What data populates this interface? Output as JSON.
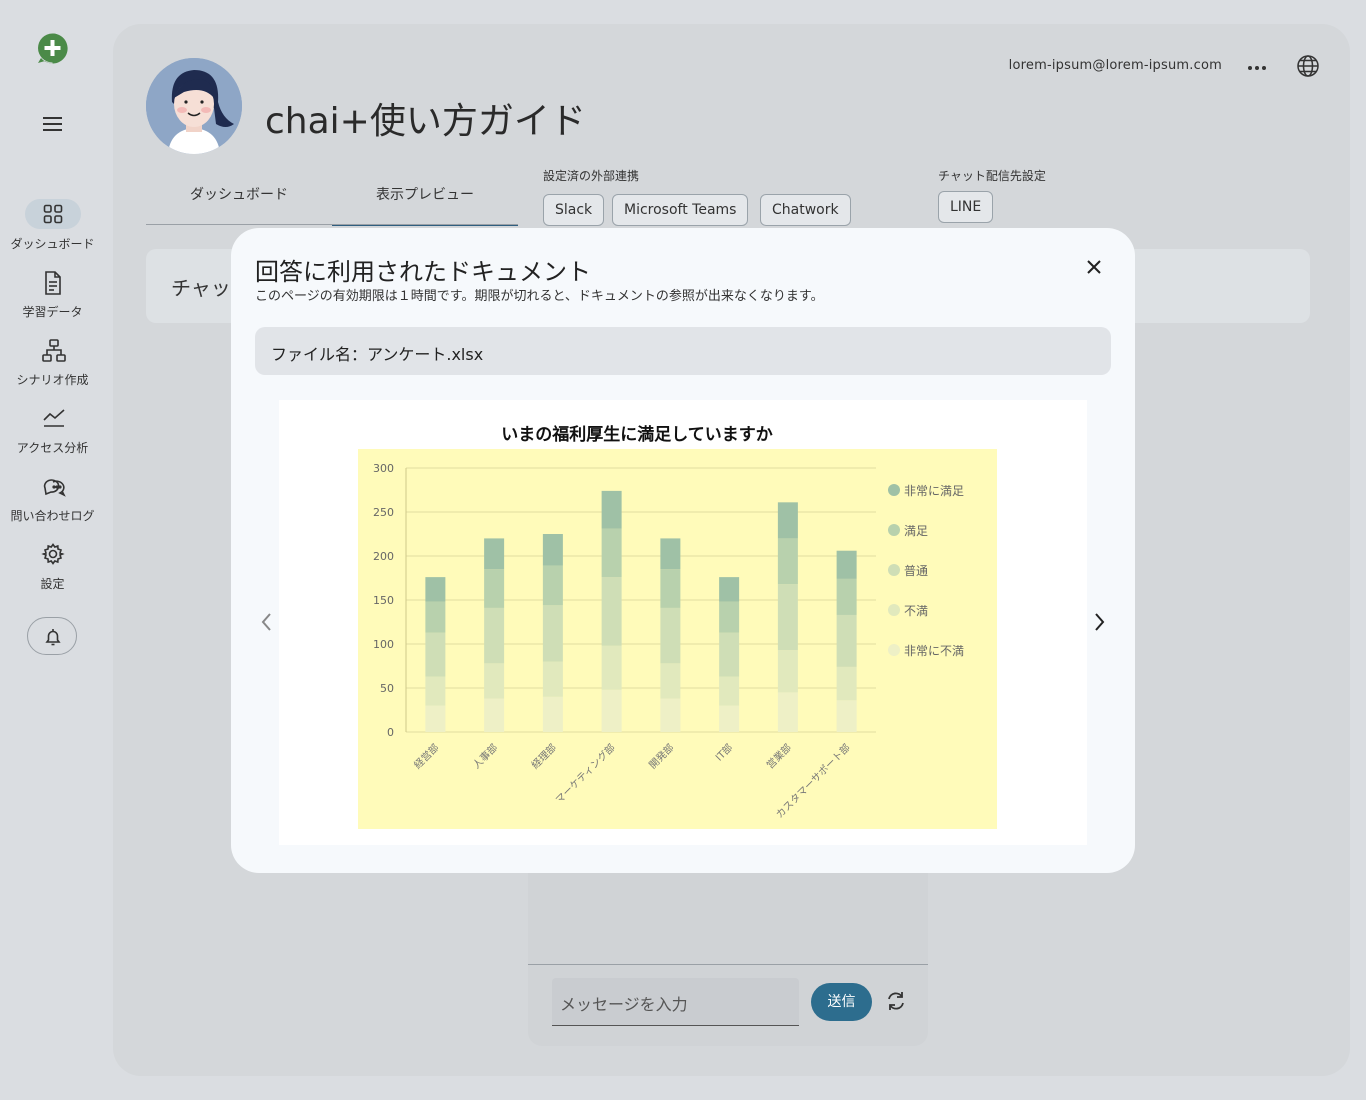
{
  "sidebar": {
    "items": [
      {
        "label": "ダッシュボード",
        "icon": "grid-icon",
        "active": true
      },
      {
        "label": "学習データ",
        "icon": "document-icon"
      },
      {
        "label": "シナリオ作成",
        "icon": "hierarchy-icon"
      },
      {
        "label": "アクセス分析",
        "icon": "trend-icon"
      },
      {
        "label": "問い合わせログ",
        "icon": "chat-bubbles-icon"
      },
      {
        "label": "設定",
        "icon": "gear-icon"
      }
    ]
  },
  "header": {
    "title": "chai+使い方ガイド",
    "email": "lorem-ipsum@lorem-ipsum.com"
  },
  "tabs": [
    {
      "label": "ダッシュボード"
    },
    {
      "label": "表示プレビュー",
      "active": true
    }
  ],
  "integrations": {
    "label": "設定済の外部連携",
    "items": [
      "Slack",
      "Microsoft Teams",
      "Chatwork"
    ]
  },
  "chat_delivery": {
    "label": "チャット配信先設定",
    "items": [
      "LINE"
    ]
  },
  "chat_bar": {
    "text": "チャッ"
  },
  "preview": {
    "placeholder": "メッセージを入力",
    "send_label": "送信"
  },
  "modal": {
    "title": "回答に利用されたドキュメント",
    "subtitle": "このページの有効期限は１時間です。期限が切れると、ドキュメントの参照が出来なくなります。",
    "file_label": "ファイル名：アンケート.xlsx"
  },
  "chart_data": {
    "type": "bar",
    "stacked": true,
    "title": "いまの福利厚生に満足していますか",
    "categories": [
      "経営部",
      "人事部",
      "経理部",
      "マーケティング部",
      "開発部",
      "IT部",
      "営業部",
      "カスタマーサポート部"
    ],
    "ylim": [
      0,
      300
    ],
    "yticks": [
      0,
      50,
      100,
      150,
      200,
      250,
      300
    ],
    "legend_position": "right",
    "series": [
      {
        "name": "非常に不満",
        "color": "#eef0c6",
        "values": [
          30,
          38,
          40,
          48,
          38,
          30,
          45,
          36
        ]
      },
      {
        "name": "不満",
        "color": "#e1e9bd",
        "values": [
          33,
          40,
          40,
          50,
          40,
          33,
          48,
          38
        ]
      },
      {
        "name": "普通",
        "color": "#cfdeb6",
        "values": [
          50,
          63,
          64,
          78,
          63,
          50,
          75,
          59
        ]
      },
      {
        "name": "満足",
        "color": "#b8d1ad",
        "values": [
          35,
          44,
          45,
          55,
          44,
          35,
          52,
          41
        ]
      },
      {
        "name": "非常に満足",
        "color": "#9fc1a6",
        "values": [
          28,
          35,
          36,
          43,
          35,
          28,
          41,
          32
        ]
      }
    ],
    "plot_background": "#fffbba"
  }
}
